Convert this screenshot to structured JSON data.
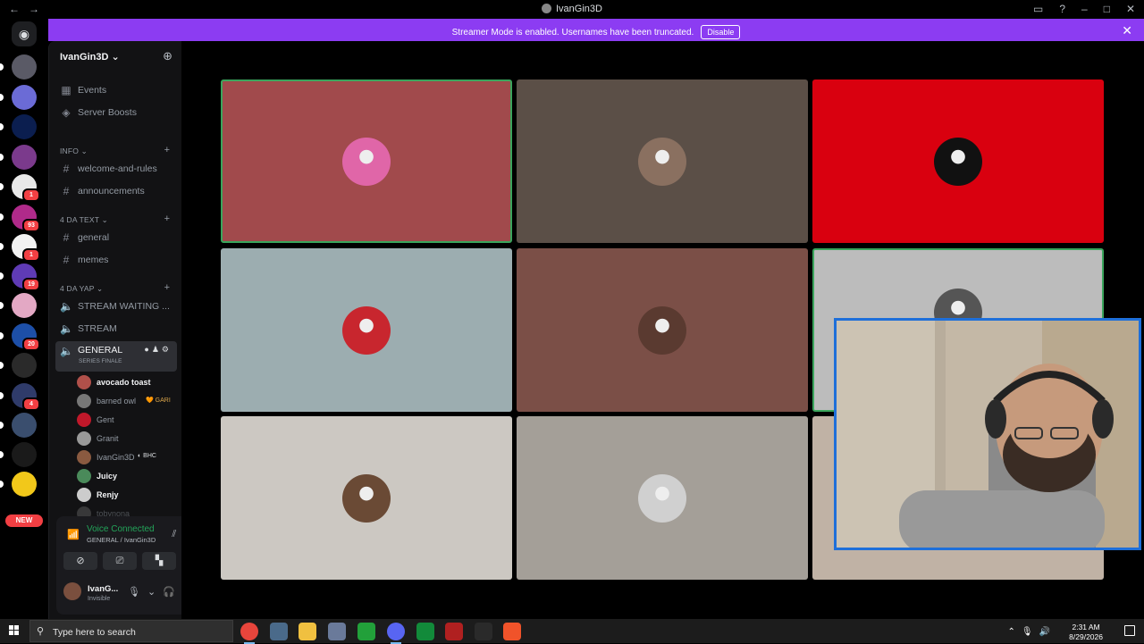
{
  "window": {
    "title": "IvanGin3D",
    "back_icon": "arrow-left",
    "forward_icon": "arrow-right"
  },
  "banner": {
    "message": "Streamer Mode is enabled. Usernames have been truncated.",
    "disable_label": "Disable",
    "color": "#8c3cf2"
  },
  "guilds": [
    {
      "badge": "",
      "color": "#5a5a66"
    },
    {
      "badge": "",
      "color": "#6b6bd6"
    },
    {
      "badge": "",
      "color": "#0b1e4f"
    },
    {
      "badge": "",
      "color": "#7b3a8c"
    },
    {
      "badge": "1",
      "color": "#e8e8e8"
    },
    {
      "badge": "93",
      "color": "#b02a8a"
    },
    {
      "badge": "1",
      "color": "#f2f2f2"
    },
    {
      "badge": "19",
      "color": "#5f3bb5"
    },
    {
      "badge": "",
      "color": "#e3a8c4"
    },
    {
      "badge": "20",
      "color": "#1d4fa8"
    },
    {
      "badge": "",
      "color": "#2a2a2a"
    },
    {
      "badge": "4",
      "color": "#2f3b6a"
    },
    {
      "badge": "",
      "color": "#3a4e6e"
    },
    {
      "badge": "",
      "color": "#1a1a1a"
    },
    {
      "badge": "",
      "color": "#f2c81a"
    }
  ],
  "new_tag": "NEW",
  "server": {
    "name": "IvanGin3D",
    "events": "Events",
    "boosts": "Server Boosts"
  },
  "categories": {
    "info": "INFO",
    "text": "4 DA TEXT",
    "yap": "4 DA YAP"
  },
  "channels": {
    "welcome": "welcome-and-rules",
    "announcements": "announcements",
    "general": "general",
    "memes": "memes",
    "stream_waiting": "STREAM WAITING ...",
    "stream": "STREAM",
    "voice_general": "GENERAL",
    "voice_general_status": "SERIES FINALE"
  },
  "voice_users": [
    {
      "name": "avocado toast",
      "bold": true,
      "tag": "",
      "color": "#b0504a"
    },
    {
      "name": "barned owl",
      "bold": false,
      "tag": "🧡 GARI",
      "color": "#777"
    },
    {
      "name": "Gent",
      "bold": false,
      "tag": "",
      "color": "#c0182a"
    },
    {
      "name": "Granit",
      "bold": false,
      "tag": "",
      "color": "#999"
    },
    {
      "name": "IvanGin3D",
      "bold": false,
      "tag": "◐ BHC",
      "color": "#8a5a40"
    },
    {
      "name": "Juicy",
      "bold": true,
      "tag": "",
      "color": "#4a8a5a"
    },
    {
      "name": "Renjy",
      "bold": true,
      "tag": "",
      "color": "#ccc"
    },
    {
      "name": "tobynona",
      "bold": false,
      "tag": "",
      "color": "#666"
    }
  ],
  "voice_panel": {
    "status": "Voice Connected",
    "location": "GENERAL / IvanGin3D"
  },
  "me": {
    "name": "IvanG...",
    "status": "Invisible"
  },
  "tiles": [
    {
      "bg": "#a14a4c",
      "avatar": "#e066a8",
      "speaking": true
    },
    {
      "bg": "#5b4f47",
      "avatar": "#8a7060",
      "speaking": false
    },
    {
      "bg": "#d9000f",
      "avatar": "#111111",
      "speaking": false
    },
    {
      "bg": "#9cadb0",
      "avatar": "#c8262e",
      "speaking": false
    },
    {
      "bg": "#7b4f47",
      "avatar": "#5a3a30",
      "speaking": false
    },
    {
      "bg": "#bcbcbc",
      "avatar": "#555555",
      "speaking": true
    },
    {
      "bg": "#ccc8c2",
      "avatar": "#6a4a35",
      "speaking": false
    },
    {
      "bg": "#a49f98",
      "avatar": "#d0d0d0",
      "speaking": false
    },
    {
      "bg": "#c0b2a5",
      "avatar": "#c0b2a5",
      "speaking": false
    }
  ],
  "taskbar": {
    "search_placeholder": "Type here to search",
    "time": "2:31 AM",
    "date": "8/29/2026",
    "apps": [
      {
        "name": "chrome",
        "color": "#e8453c"
      },
      {
        "name": "calculator",
        "color": "#4a6a8a"
      },
      {
        "name": "file-explorer",
        "color": "#f0c040"
      },
      {
        "name": "app",
        "color": "#6a7a9a"
      },
      {
        "name": "xbox",
        "color": "#22a03a"
      },
      {
        "name": "discord",
        "color": "#5865f2"
      },
      {
        "name": "xbox-game-bar",
        "color": "#128a3a"
      },
      {
        "name": "app-2",
        "color": "#b02020"
      },
      {
        "name": "app-3",
        "color": "#2a2a2a"
      },
      {
        "name": "brave",
        "color": "#f0532a"
      }
    ]
  }
}
